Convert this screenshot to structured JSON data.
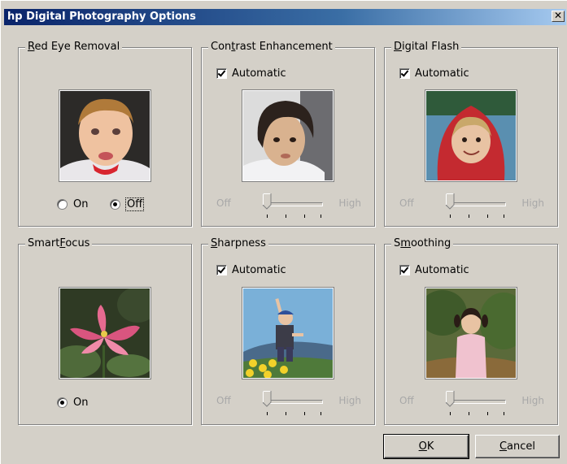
{
  "window": {
    "title": "hp Digital Photography Options",
    "close_glyph": "✕"
  },
  "groups": {
    "red_eye": {
      "label_prefix": "",
      "label_ul": "R",
      "label_rest": "ed Eye Removal",
      "options": {
        "on_label": "On",
        "off_label": "Off",
        "selected": "Off"
      }
    },
    "contrast": {
      "label_prefix": "Con",
      "label_ul": "t",
      "label_rest": "rast Enhancement",
      "automatic_label": "Automatic",
      "automatic_checked": true,
      "slider": {
        "min_label": "Off",
        "max_label": "High"
      }
    },
    "digital_flash": {
      "label_prefix": "",
      "label_ul": "D",
      "label_rest": "igital Flash",
      "automatic_label": "Automatic",
      "automatic_checked": true,
      "slider": {
        "min_label": "Off",
        "max_label": "High"
      }
    },
    "smartfocus": {
      "label_prefix": "Smart",
      "label_ul": "F",
      "label_rest": "ocus",
      "options": {
        "on_label": "On",
        "selected": "On"
      }
    },
    "sharpness": {
      "label_prefix": "",
      "label_ul": "S",
      "label_rest": "harpness",
      "automatic_label": "Automatic",
      "automatic_checked": true,
      "slider": {
        "min_label": "Off",
        "max_label": "High"
      }
    },
    "smoothing": {
      "label_prefix": "S",
      "label_ul": "m",
      "label_rest": "oothing",
      "automatic_label": "Automatic",
      "automatic_checked": true,
      "slider": {
        "min_label": "Off",
        "max_label": "High"
      }
    }
  },
  "buttons": {
    "ok_ul": "O",
    "ok_rest": "K",
    "cancel_ul": "C",
    "cancel_rest": "ancel"
  },
  "colors": {
    "title_start": "#0a246a",
    "title_end": "#a6caf0",
    "face": "#d4d0c8"
  },
  "icons": {
    "close": "close-icon",
    "check": "checkmark-icon",
    "radio": "radio-dot-icon"
  }
}
